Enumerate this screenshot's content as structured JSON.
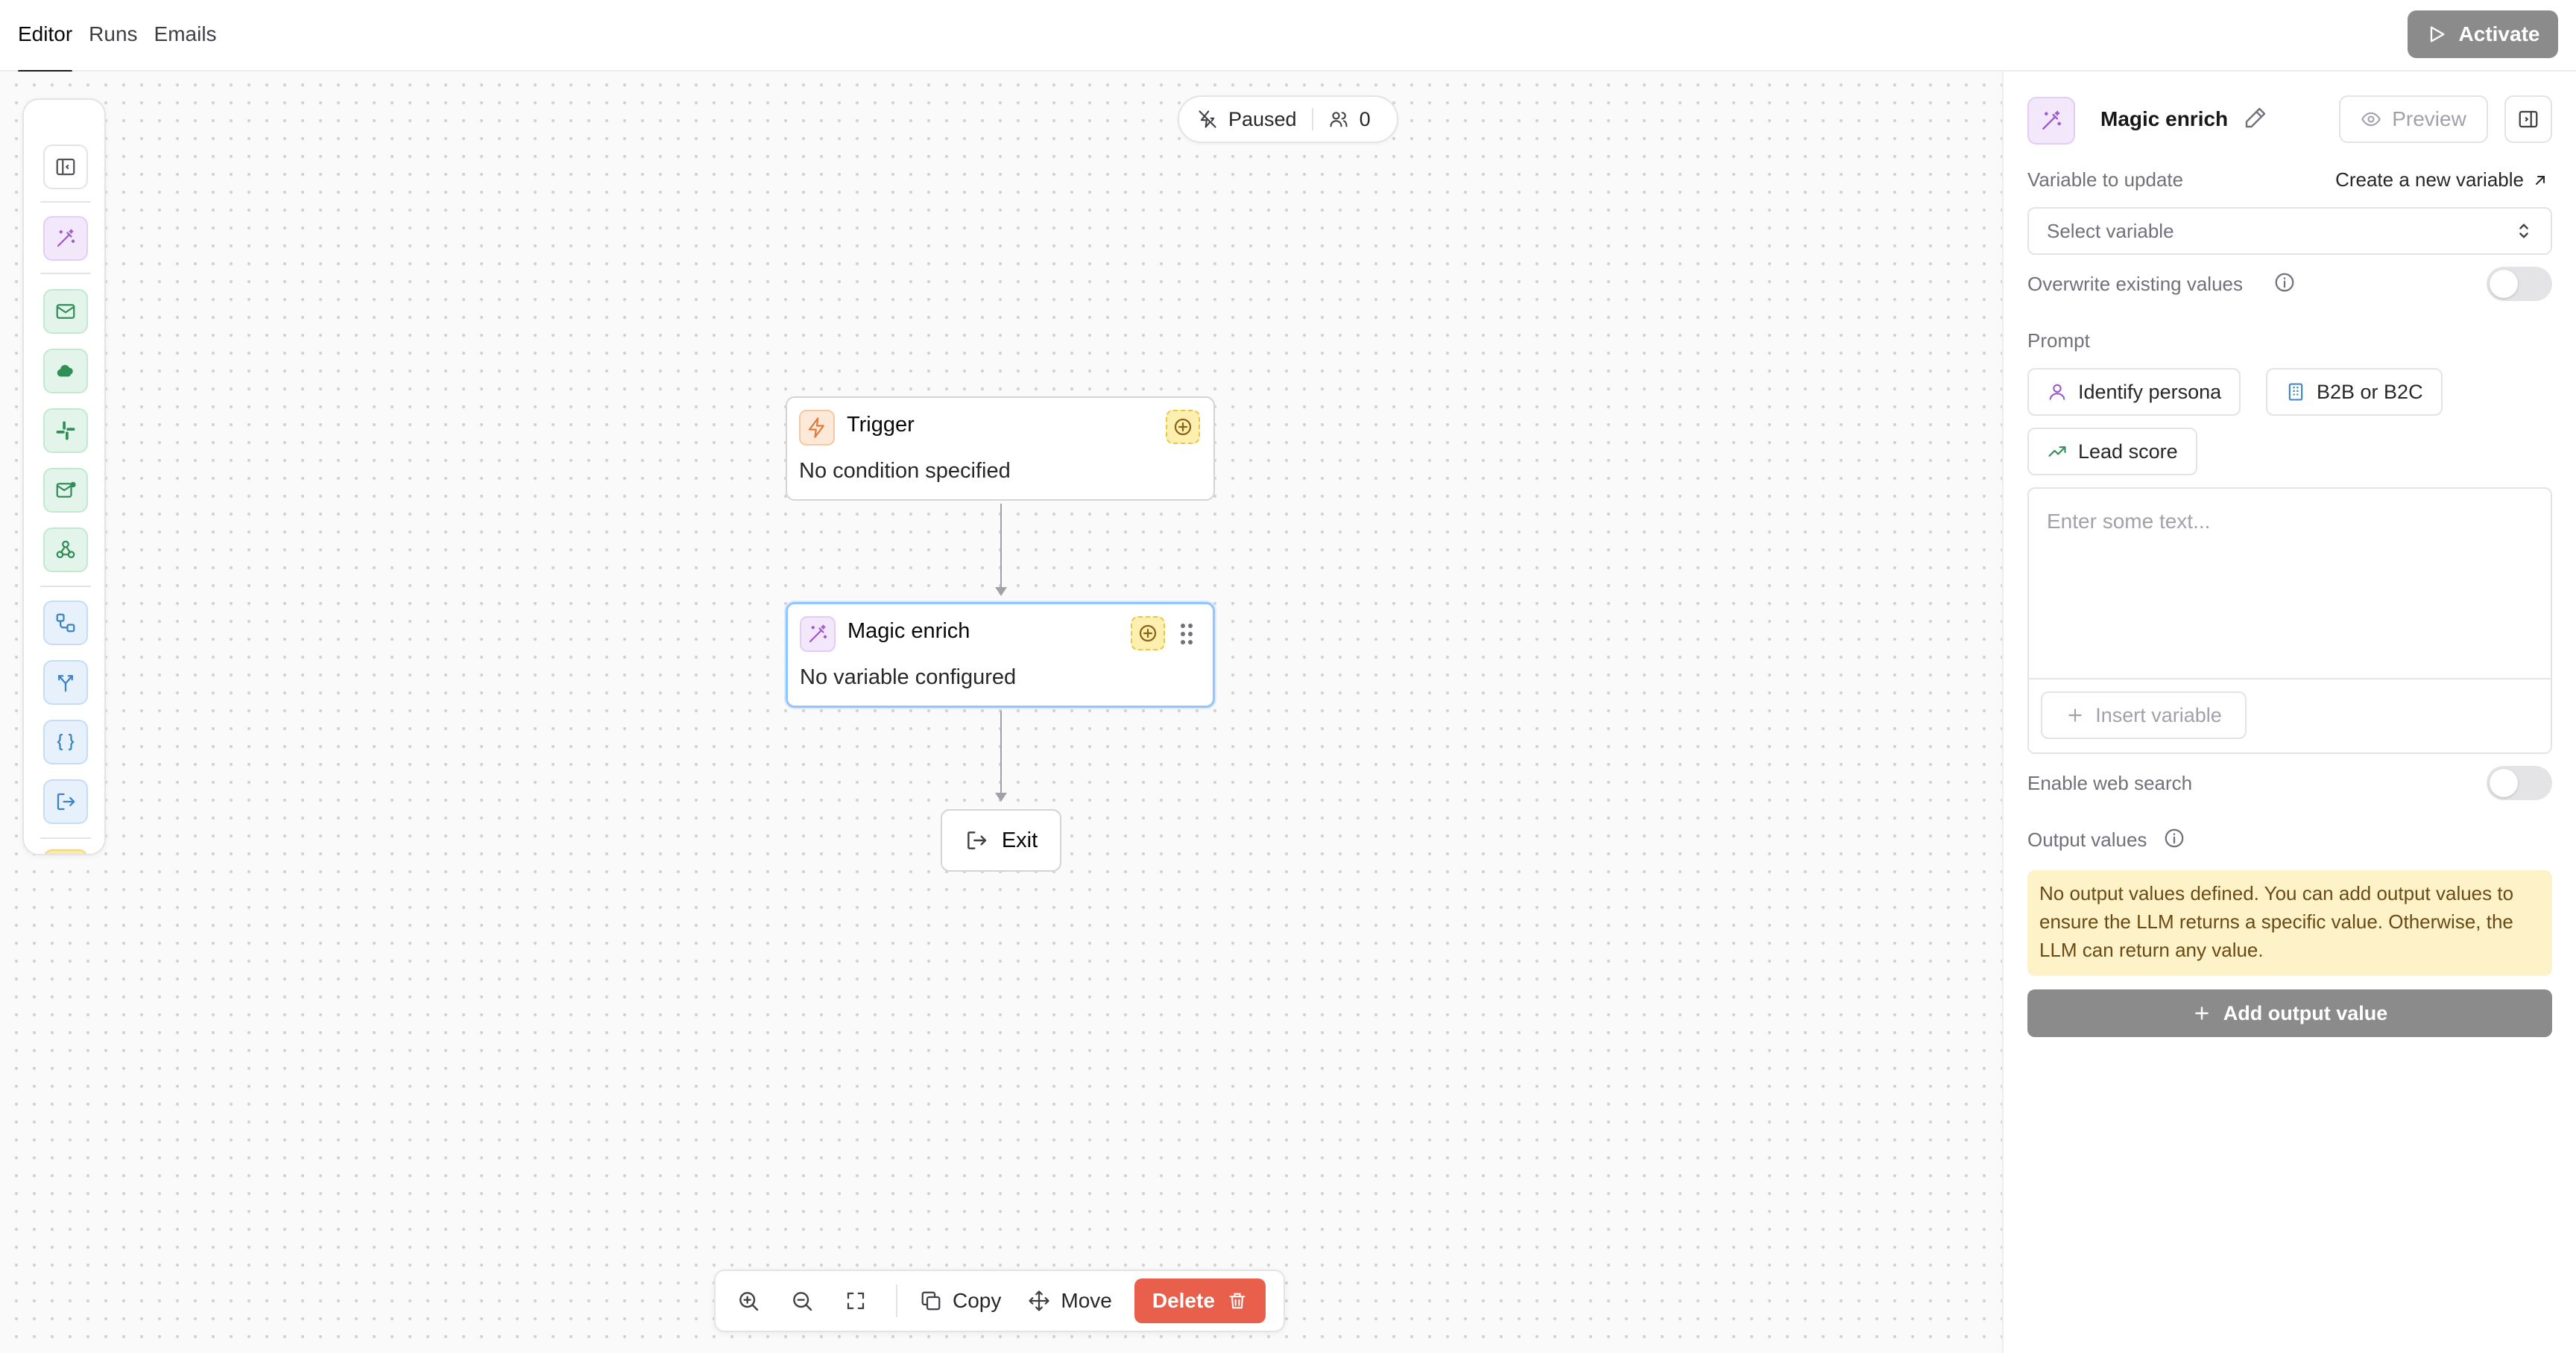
{
  "tabs": [
    {
      "label": "Editor",
      "active": true
    },
    {
      "label": "Runs",
      "active": false
    },
    {
      "label": "Emails",
      "active": false
    }
  ],
  "header": {
    "activate_label": "Activate"
  },
  "status": {
    "state": "Paused",
    "count": "0"
  },
  "palette": {
    "items": [
      "sidebar-toggle-icon",
      "magic-wand-icon",
      "mail-icon",
      "cloud-icon",
      "slack-icon",
      "mail-badge-icon",
      "webhook-icon",
      "workflow-icon",
      "split-icon",
      "code-braces-icon",
      "exit-icon",
      "timer-icon"
    ]
  },
  "nodes": {
    "trigger": {
      "title": "Trigger",
      "subtitle": "No condition specified",
      "icon": "lightning-icon"
    },
    "enrich": {
      "title": "Magic enrich",
      "subtitle": "No variable configured",
      "icon": "magic-wand-icon"
    },
    "exit": {
      "title": "Exit",
      "icon": "exit-icon"
    }
  },
  "toolbar": {
    "copy_label": "Copy",
    "move_label": "Move",
    "delete_label": "Delete"
  },
  "panel": {
    "title": "Magic enrich",
    "preview_label": "Preview",
    "variable_label": "Variable to update",
    "create_variable_label": "Create a new variable",
    "select_placeholder": "Select variable",
    "overwrite_label": "Overwrite existing values",
    "prompt_label": "Prompt",
    "chips": [
      "Identify persona",
      "B2B or B2C",
      "Lead score"
    ],
    "prompt_placeholder": "Enter some text...",
    "insert_variable_label": "Insert variable",
    "web_search_label": "Enable web search",
    "output_label": "Output values",
    "output_notice": "No output values defined. You can add output values to ensure the LLM returns a specific value. Otherwise, the LLM can return any value.",
    "add_output_label": "Add output value"
  },
  "colors": {
    "accent_purple": "#9b59c9",
    "accent_green": "#2f8f57",
    "accent_blue": "#3b82c4",
    "trigger_orange": "#e2793a",
    "delete_red": "#e8604c",
    "selected_border": "#93c5fd"
  }
}
